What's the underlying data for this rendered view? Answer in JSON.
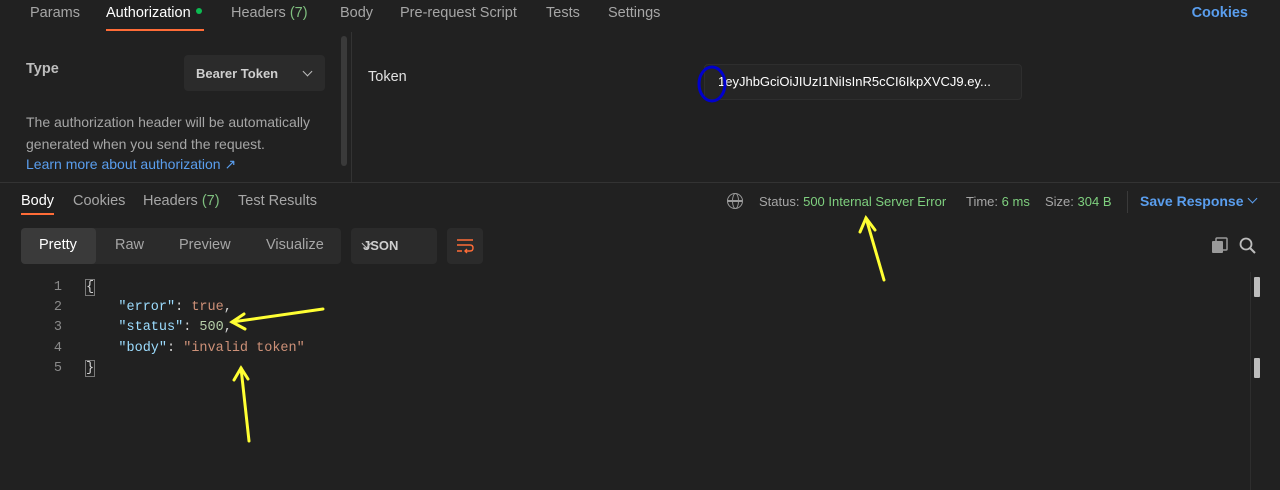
{
  "request_tabs": [
    {
      "label": "Params"
    },
    {
      "label": "Authorization"
    },
    {
      "label": "Headers",
      "count": "(7)"
    },
    {
      "label": "Body"
    },
    {
      "label": "Pre-request Script"
    },
    {
      "label": "Tests"
    },
    {
      "label": "Settings"
    }
  ],
  "cookies_label": "Cookies",
  "auth": {
    "type_label": "Type",
    "type_value": "Bearer Token",
    "description": "The authorization header will be automatically generated when you send the request.",
    "learn_more": "Learn more about authorization ↗",
    "token_label": "Token",
    "token_value": "1eyJhbGciOiJIUzI1NiIsInR5cCI6IkpXVCJ9.ey..."
  },
  "response_tabs": [
    {
      "label": "Body"
    },
    {
      "label": "Cookies"
    },
    {
      "label": "Headers",
      "count": "(7)"
    },
    {
      "label": "Test Results"
    }
  ],
  "response_stats": {
    "status_label": "Status:",
    "status_value": "500 Internal Server Error",
    "time_label": "Time:",
    "time_value": "6 ms",
    "size_label": "Size:",
    "size_value": "304 B",
    "save_label": "Save Response"
  },
  "view_modes": [
    "Pretty",
    "Raw",
    "Preview",
    "Visualize"
  ],
  "format_value": "JSON",
  "code": {
    "line_numbers": [
      "1",
      "2",
      "3",
      "4",
      "5"
    ],
    "open_brace": "{",
    "close_brace": "}",
    "error_key": "\"error\"",
    "error_val": "true",
    "status_key": "\"status\"",
    "status_val": "500",
    "body_key": "\"body\"",
    "body_val": "\"invalid token\""
  },
  "colors": {
    "accent": "#ff6c37",
    "link": "#5a9eee",
    "success": "#7fd07f",
    "annotation_arrow": "#ffff33",
    "annotation_circle": "#0000cc"
  },
  "icons": [
    "globe-icon",
    "chevron-down-icon",
    "wrap-lines-icon",
    "copy-icon",
    "search-icon"
  ]
}
